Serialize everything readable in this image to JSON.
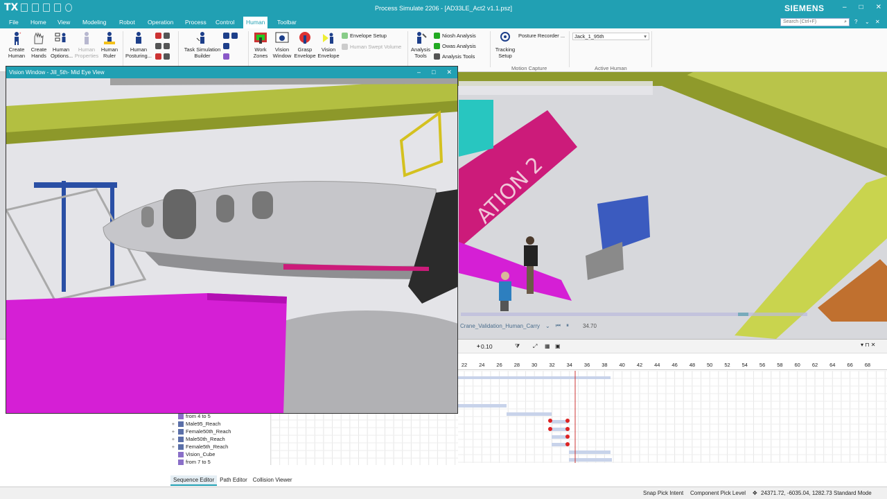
{
  "app": {
    "logo": "TX",
    "title": "Process Simulate 2206 - [AD33LE_Act2 v1.1.psz]",
    "brand": "SIEMENS",
    "window_buttons": [
      "–",
      "□",
      "✕"
    ]
  },
  "menu": {
    "tabs": [
      "File",
      "Home",
      "View",
      "Modeling",
      "Robot",
      "Operation",
      "Process",
      "Control",
      "Human",
      "Toolbar"
    ],
    "active": "Human",
    "search_placeholder": "Search (Ctrl+F)"
  },
  "ribbon": {
    "buttons": [
      {
        "label": "Create\nHuman",
        "dropdown": true,
        "icon": "human-icon"
      },
      {
        "label": "Create\nHands",
        "icon": "hands-icon"
      },
      {
        "label": "Human\nOptions...",
        "icon": "human-options-icon"
      },
      {
        "label": "Human\nProperties",
        "icon": "human-properties-icon",
        "disabled": true
      },
      {
        "label": "Human\nRuler",
        "icon": "ruler-icon"
      },
      {
        "label": "Human\nPosturing...",
        "icon": "posturing-icon"
      },
      {
        "label": "Task Simulation\nBuilder",
        "icon": "task-builder-icon"
      },
      {
        "label": "Work\nZones",
        "icon": "work-zones-icon"
      },
      {
        "label": "Vision\nWindow",
        "icon": "vision-window-icon"
      },
      {
        "label": "Grasp\nEnvelope",
        "icon": "grasp-envelope-icon"
      },
      {
        "label": "Vision\nEnvelope",
        "icon": "vision-envelope-icon"
      },
      {
        "label": "Analysis\nTools",
        "dropdown": true,
        "icon": "analysis-tools-icon"
      },
      {
        "label": "Tracking\nSetup",
        "dropdown": true,
        "icon": "tracking-icon"
      }
    ],
    "small_items": {
      "envelope_setup": "Envelope Setup",
      "human_swept_volume": "Human Swept Volume",
      "niosh": "Niosh Analysis",
      "owas": "Owas Analysis",
      "analysis_tools": "Analysis Tools",
      "posture_recorder": "Posture Recorder ..."
    },
    "groups": {
      "motion_capture": "Motion Capture",
      "active_human": "Active Human"
    },
    "active_human_value": "Jack_1_95th"
  },
  "vision_window": {
    "title": "Vision Window - Jill_5th- Mid Eye View"
  },
  "viewport": {
    "floor_text": "ATION 2"
  },
  "playback": {
    "operation": "Crane_Validation_Human_Carry",
    "time": "34.70"
  },
  "sequence_editor": {
    "zoom": "0.10",
    "ticks": [
      "22",
      "24",
      "26",
      "28",
      "30",
      "32",
      "34",
      "36",
      "38",
      "40",
      "42",
      "44",
      "46",
      "48",
      "50",
      "52",
      "54",
      "56",
      "58",
      "60",
      "62",
      "64",
      "66",
      "68"
    ],
    "tree_rows": [
      {
        "label": "from 4 to 5",
        "expander": false
      },
      {
        "label": "Male95_Reach",
        "expander": true
      },
      {
        "label": "Female50th_Reach",
        "expander": true
      },
      {
        "label": "Male50th_Reach",
        "expander": true
      },
      {
        "label": "Female5th_Reach",
        "expander": true
      },
      {
        "label": "Vision_Cube",
        "expander": false
      },
      {
        "label": "from 7 to 5",
        "expander": false
      }
    ],
    "bottom_tabs": [
      "Sequence Editor",
      "Path Editor",
      "Collision Viewer"
    ],
    "active_tab": "Sequence Editor"
  },
  "status": {
    "snap": "Snap Pick Intent",
    "pick_level": "Component Pick Level",
    "coords": "24371.72, -6035.04, 1282.73",
    "mode": "Standard Mode"
  },
  "colors": {
    "accent": "#21a0b3",
    "magenta": "#cc00cc",
    "beam": "#c8d24a"
  }
}
